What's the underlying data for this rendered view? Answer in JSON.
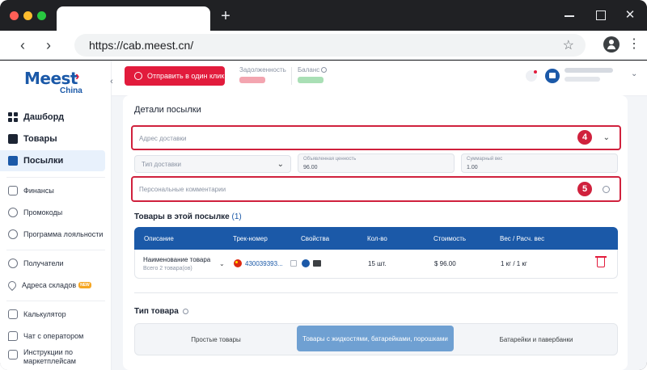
{
  "browser": {
    "url": "https://cab.meest.cn/"
  },
  "brand": {
    "name": "Meest",
    "sub": "China",
    "colors": {
      "primary": "#1b59a8",
      "accent": "#e21b3c",
      "highlight": "#d0213d"
    }
  },
  "sidebar": {
    "items": [
      {
        "label": "Дашборд",
        "icon": "dashboard-icon"
      },
      {
        "label": "Товары",
        "icon": "box-icon"
      },
      {
        "label": "Посылки",
        "icon": "parcel-icon"
      },
      {
        "label": "Финансы",
        "icon": "wallet-icon"
      },
      {
        "label": "Промокоды",
        "icon": "percent-icon"
      },
      {
        "label": "Программа лояльности",
        "icon": "loyalty-icon"
      },
      {
        "label": "Получатели",
        "icon": "users-icon"
      },
      {
        "label": "Адреса складов",
        "icon": "pin-icon",
        "badge": "NEW"
      },
      {
        "label": "Калькулятор",
        "icon": "calculator-icon"
      },
      {
        "label": "Чат с оператором",
        "icon": "chat-icon"
      },
      {
        "label": "Инструкции по маркетплейсам",
        "icon": "book-icon"
      }
    ]
  },
  "header": {
    "send_button": "Отправить в один клик",
    "debt_label": "Задолженность",
    "balance_label": "Баланс"
  },
  "card": {
    "title": "Детали посылки",
    "address_placeholder": "Адрес доставки",
    "delivery_type_placeholder": "Тип доставки",
    "declared_value_label": "Объявленная ценность",
    "declared_value": "96.00",
    "total_weight_label": "Суммарный вес",
    "total_weight": "1.00",
    "comment_placeholder": "Персональные комментарии",
    "badges": {
      "address": "4",
      "comment": "5"
    }
  },
  "goods": {
    "title": "Товары в этой посылке",
    "count": "(1)",
    "columns": [
      "Описание",
      "Трек-номер",
      "Свойства",
      "Кол-во",
      "Стоимость",
      "Вес / Расч. вес"
    ],
    "rows": [
      {
        "name": "Наименование товара",
        "sub": "Всего 2 товара(ов)",
        "track": "430039393...",
        "qty": "15 шт.",
        "price": "$ 96.00",
        "weight": "1 кг / 1 кг"
      }
    ]
  },
  "product_type": {
    "title": "Тип товара",
    "options": [
      "Простые товары",
      "Товары с жидкостями, батарейками, порошками",
      "Батарейки и павербанки"
    ],
    "selected_index": 1
  }
}
